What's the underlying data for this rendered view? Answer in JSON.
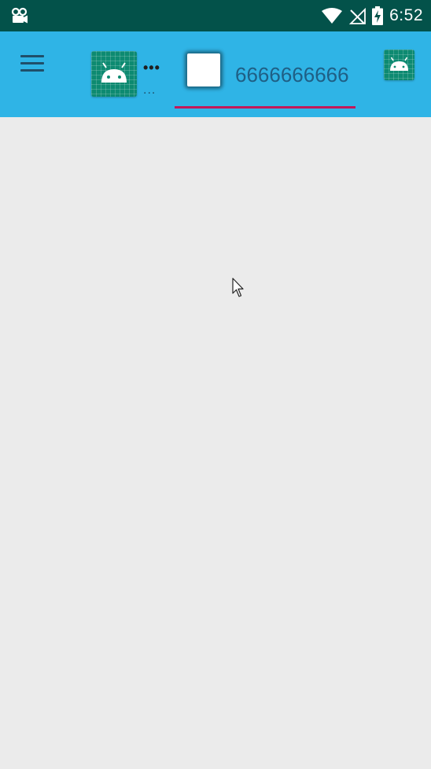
{
  "status_bar": {
    "time": "6:52",
    "left_icon": "video-camera-icon",
    "icons": [
      "wifi-icon",
      "no-signal-icon",
      "battery-charging-icon"
    ]
  },
  "toolbar": {
    "menu_icon": "hamburger-menu-icon",
    "tabs": [
      {
        "icon": "android-icon",
        "label_top": "•••",
        "label_bottom": "..."
      },
      {
        "icon": "white-square-icon",
        "label": "6666666666",
        "selected": true
      }
    ],
    "right_icon": "android-icon"
  },
  "colors": {
    "status_bar": "#03524a",
    "toolbar": "#2fb4e6",
    "tab_indicator": "#c2185b",
    "content_background": "#ebebeb",
    "android_tile": "#0d8a71"
  }
}
